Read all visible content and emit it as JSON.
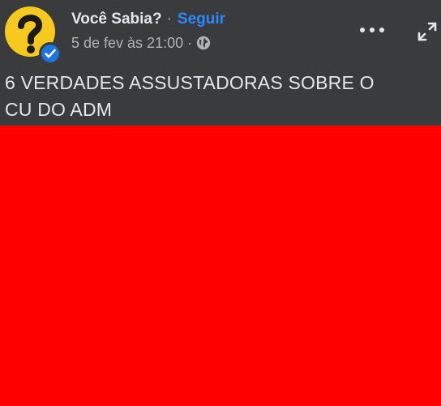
{
  "post": {
    "page_name": "Você Sabia?",
    "name_separator": "·",
    "follow_label": "Seguir",
    "timestamp": "5 de fev às 21:00",
    "meta_separator": "·",
    "audience_icon": "globe-icon",
    "text_line_1": "6 VERDADES ASSUSTADORAS SOBRE O",
    "text_line_2": "CU DO ADM"
  },
  "icons": {
    "avatar": "question-mark-avatar",
    "verified": "verified-badge-icon",
    "more": "more-options-icon",
    "expand": "expand-icon"
  },
  "colors": {
    "header_bg": "#3a3b3c",
    "text_primary": "#e4e6eb",
    "text_secondary": "#b0b3b8",
    "follow_blue": "#2d88ff",
    "avatar_yellow": "#f7c81e",
    "verified_blue": "#1b74e4",
    "media_red": "#ff0000"
  }
}
